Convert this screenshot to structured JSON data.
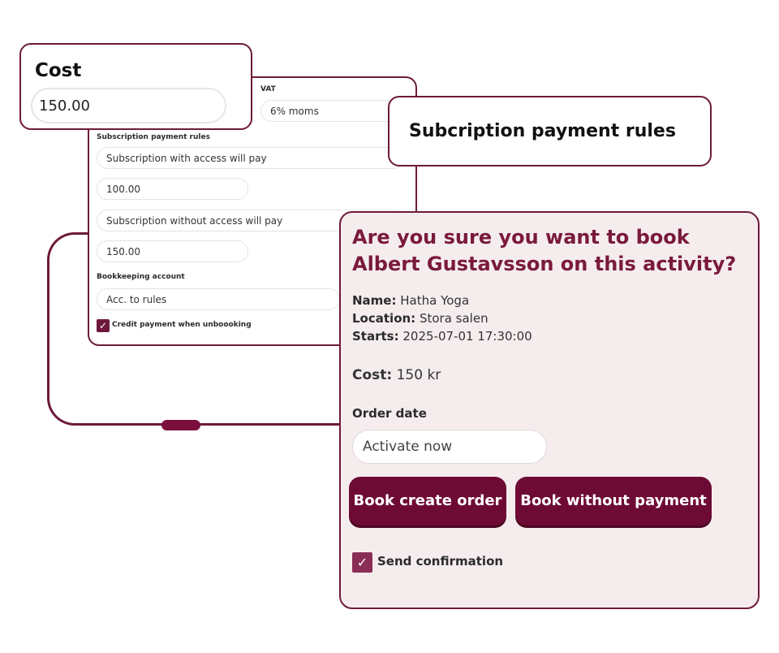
{
  "settings_panel": {
    "vat_label": "VAT",
    "vat_value": "6% moms",
    "subscription_rules_label": "Subscription payment rules",
    "with_access_label": "Subscription with access will pay",
    "with_access_value": "100.00",
    "without_access_label": "Subscription without access will pay",
    "without_access_value": "150.00",
    "bookkeeping_label": "Bookkeeping account",
    "bookkeeping_value": "Acc. to rules",
    "credit_checkbox_label": "Credit payment when unboooking",
    "credit_checked": true
  },
  "cost_callout": {
    "title": "Cost",
    "value": "150.00"
  },
  "subscription_callout": {
    "title": "Subcription payment rules"
  },
  "dialog": {
    "title": "Are you sure you want to book Albert Gustavsson on this activity?",
    "name_label": "Name:",
    "name_value": "Hatha Yoga",
    "location_label": "Location:",
    "location_value": "Stora salen",
    "starts_label": "Starts:",
    "starts_value": "2025-07-01 17:30:00",
    "cost_label": "Cost:",
    "cost_value": "150 kr",
    "order_date_label": "Order date",
    "order_date_value": "Activate now",
    "book_create_order": "Book create order",
    "book_without_payment": "Book without payment",
    "send_confirmation_label": "Send confirmation",
    "send_confirmation_checked": true
  },
  "colors": {
    "accent": "#6e1a3c",
    "button": "#6e0b34",
    "dialog_bg": "#f5eded"
  }
}
